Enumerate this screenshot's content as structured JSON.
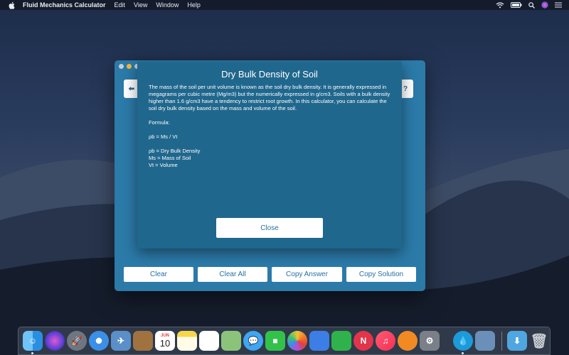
{
  "menubar": {
    "app_name": "Fluid Mechanics Calculator",
    "menus": [
      "Edit",
      "View",
      "Window",
      "Help"
    ]
  },
  "window": {
    "back_label": "⬅",
    "help_label": "?",
    "buttons": {
      "clear": "Clear",
      "clear_all": "Clear All",
      "copy_answer": "Copy Answer",
      "copy_solution": "Copy Solution"
    }
  },
  "sheet": {
    "title": "Dry Bulk Density of Soil",
    "description": "The mass of the soil per unit volume is known as the soil dry bulk density. It is generally expressed in megagrams per cubic metre (Mg/m3) but the numerically expressed in g/cm3. Soils with a bulk density higher than 1.6 g/cm3 have a tendency to restrict root growth. In this calculator, you can calculate the soil dry bulk density based on the mass and volume of the soil.",
    "formula_heading": "Formula:",
    "formula": "ρb = Ms / Vt",
    "definitions": [
      "ρb = Dry Bulk Density",
      "Ms = Mass of Soil",
      "Vt = Volume"
    ],
    "close_label": "Close"
  },
  "dock": {
    "icons": [
      "finder-icon",
      "siri-icon",
      "launchpad-icon",
      "safari-icon",
      "preview-icon",
      "notefile-icon",
      "calendar-icon",
      "notes-icon",
      "reminders-icon",
      "maps-icon",
      "messages-icon",
      "facetime-icon",
      "photos-icon",
      "keynote-icon",
      "numbers-icon",
      "news-icon",
      "music-icon",
      "books-icon",
      "system-preferences-icon",
      "drop-icon",
      "screenshot-icon",
      "downloads-folder-icon",
      "trash-icon"
    ],
    "calendar_month": "JUN",
    "calendar_day": "10"
  }
}
